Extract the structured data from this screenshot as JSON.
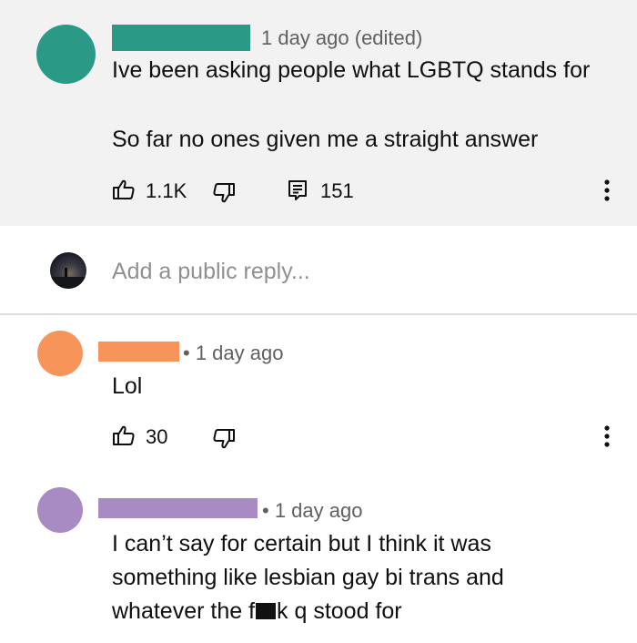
{
  "colors": {
    "top_avatar": "#2a9a87",
    "top_name_bar": "#2a9a87",
    "reply1_avatar": "#f7945a",
    "reply1_name_bar": "#f7945a",
    "reply2_avatar": "#a98bc3",
    "reply2_name_bar": "#a98bc3"
  },
  "top_comment": {
    "time": "1 day ago (edited)",
    "line1": "Ive been asking people what LGBTQ stands for",
    "line2": "So far no ones given me a straight answer",
    "likes": "1.1K",
    "replies": "151",
    "icons": [
      "thumbs-up-icon",
      "thumbs-down-icon",
      "reply-icon",
      "more-vert-icon"
    ]
  },
  "reply_input": {
    "placeholder": "Add a public reply..."
  },
  "reply1": {
    "time": "• 1 day ago",
    "text": "Lol",
    "likes": "30"
  },
  "reply2": {
    "time": "• 1 day ago",
    "line1": "I can’t say for certain but I think it was",
    "line2": "something like lesbian gay bi trans and",
    "line3_before": "whatever the f",
    "line3_after": "k q stood for"
  }
}
